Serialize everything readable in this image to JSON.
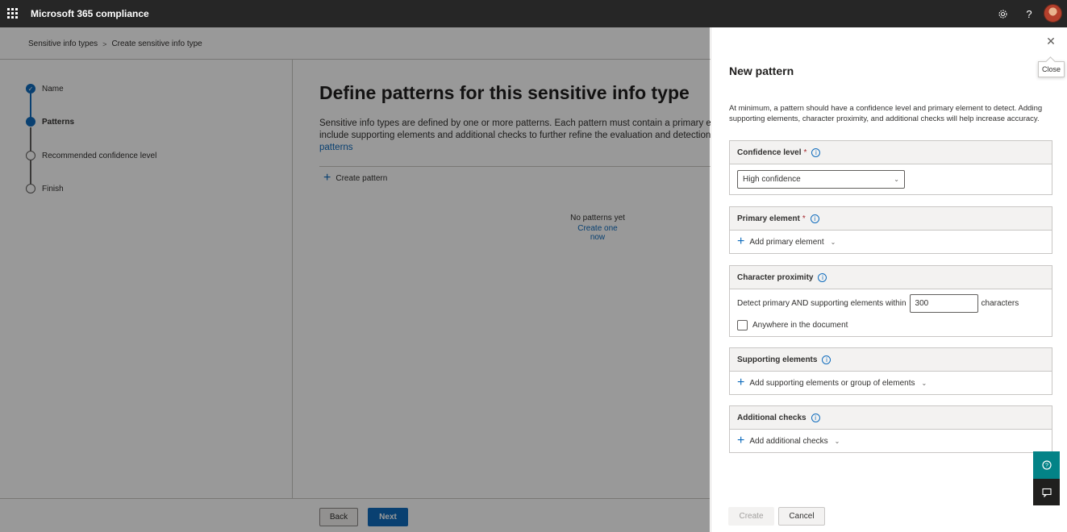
{
  "app": {
    "title": "Microsoft 365 compliance"
  },
  "topbar": {
    "settings_icon": "gear-icon",
    "help_icon": "question-icon",
    "help_glyph": "?"
  },
  "breadcrumb": {
    "items": [
      "Sensitive info types",
      "Create sensitive info type"
    ],
    "separator": ">"
  },
  "wizard": {
    "steps": [
      {
        "label": "Name",
        "state": "complete"
      },
      {
        "label": "Patterns",
        "state": "current"
      },
      {
        "label": "Recommended confidence level",
        "state": "pending"
      },
      {
        "label": "Finish",
        "state": "pending"
      }
    ]
  },
  "content": {
    "title": "Define patterns for this sensitive info type",
    "desc_line1": "Sensitive info types are defined by one or more patterns. Each pattern must contain a primary element",
    "desc_line2": "include supporting elements and additional checks to further refine the evaluation and detection of",
    "desc_link": "patterns",
    "create_pattern": "Create pattern",
    "empty_text": "No patterns yet",
    "empty_link": "Create one now"
  },
  "footer": {
    "back": "Back",
    "next": "Next"
  },
  "panel": {
    "title": "New pattern",
    "close_tooltip": "Close",
    "description": "At minimum, a pattern should have a confidence level and primary element to detect. Adding supporting elements, character proximity, and additional checks will help increase accuracy.",
    "confidence": {
      "label": "Confidence level",
      "required": "*",
      "value": "High confidence"
    },
    "primary": {
      "label": "Primary element",
      "required": "*",
      "add": "Add primary element"
    },
    "proximity": {
      "label": "Character proximity",
      "prefix": "Detect primary AND supporting elements within",
      "value": "300",
      "suffix": "characters",
      "anywhere": "Anywhere in the document",
      "anywhere_checked": false
    },
    "supporting": {
      "label": "Supporting elements",
      "add": "Add supporting elements or group of elements"
    },
    "additional": {
      "label": "Additional checks",
      "add": "Add additional checks"
    },
    "create": "Create",
    "cancel": "Cancel"
  },
  "colors": {
    "accent": "#0f6cbd",
    "topbar": "#262626",
    "help_button": "#038387"
  }
}
